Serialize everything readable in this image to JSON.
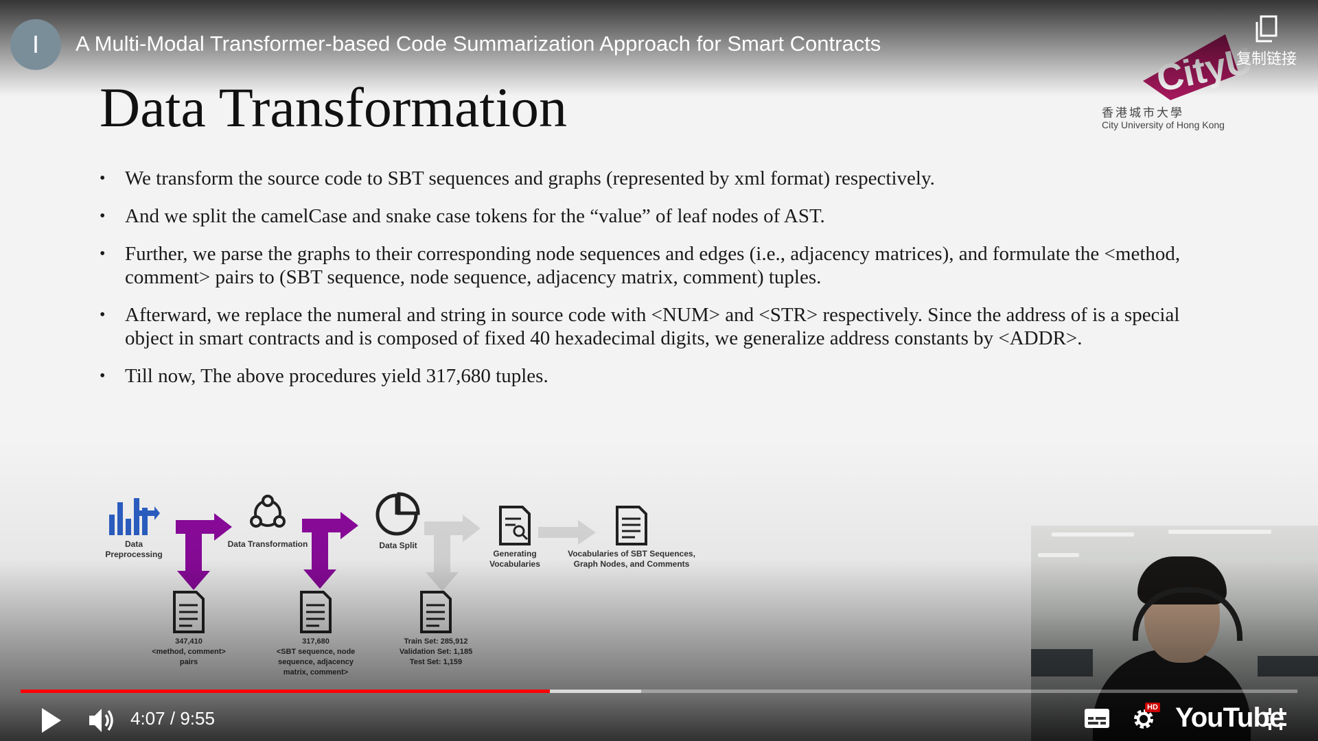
{
  "player": {
    "channel_initial": "I",
    "video_title": "A Multi-Modal Transformer-based Code Summarization Approach for Smart Contracts",
    "copy_link_label": "复制链接",
    "time_current": "4:07",
    "time_separator": "/",
    "time_total": "9:55",
    "played_fraction": 0.4146,
    "buffered_fraction": 0.486,
    "accent_color": "#ff0000",
    "settings_badge": "HD",
    "youtube_label": "YouTube",
    "icons": [
      "play-icon",
      "volume-icon",
      "subtitles-icon",
      "settings-icon",
      "exit-fullscreen-icon",
      "copy-icon"
    ]
  },
  "slide": {
    "logo": {
      "name": "CityU",
      "name_cn": "香港城市大學",
      "name_en": "City University of Hong Kong",
      "color": "#a3185b"
    },
    "title": "Data Transformation",
    "bullets": [
      "We transform the source code to SBT sequences and graphs (represented by xml format) respectively.",
      "And we split the camelCase and snake case tokens for the “value” of leaf nodes of AST.",
      "Further, we parse the graphs to their corresponding node sequences and edges (i.e., adjacency matrices), and formulate the <method, comment> pairs to (SBT sequence, node sequence, adjacency matrix, comment) tuples.",
      "Afterward, we replace the numeral and string in source code with <NUM> and <STR> respectively. Since the address of is a special object in smart contracts and is composed of fixed 40 hexadecimal digits, we generalize address constants by <ADDR>.",
      "Till now, The above procedures yield 317,680 tuples."
    ],
    "diagram": {
      "arrow_color": "#8b0a9c",
      "icon_color": "#2b5fc4",
      "steps": [
        {
          "label": "Data Preprocessing"
        },
        {
          "label": "Data Transformation"
        },
        {
          "label": "Data Split"
        },
        {
          "label": "Generating Vocabularies"
        },
        {
          "label": "Vocabularies of SBT Sequences, Graph Nodes, and Comments"
        }
      ],
      "outputs": [
        {
          "line1": "347,410",
          "line2": "<method, comment>",
          "line3": "pairs",
          "line4": ""
        },
        {
          "line1": "317,680",
          "line2": "<SBT sequence, node",
          "line3": "sequence, adjacency",
          "line4": "matrix, comment>"
        },
        {
          "line1": "Train Set: 285,912",
          "line2": "Validation Set: 1,185",
          "line3": "Test Set: 1,159",
          "line4": ""
        }
      ]
    }
  }
}
